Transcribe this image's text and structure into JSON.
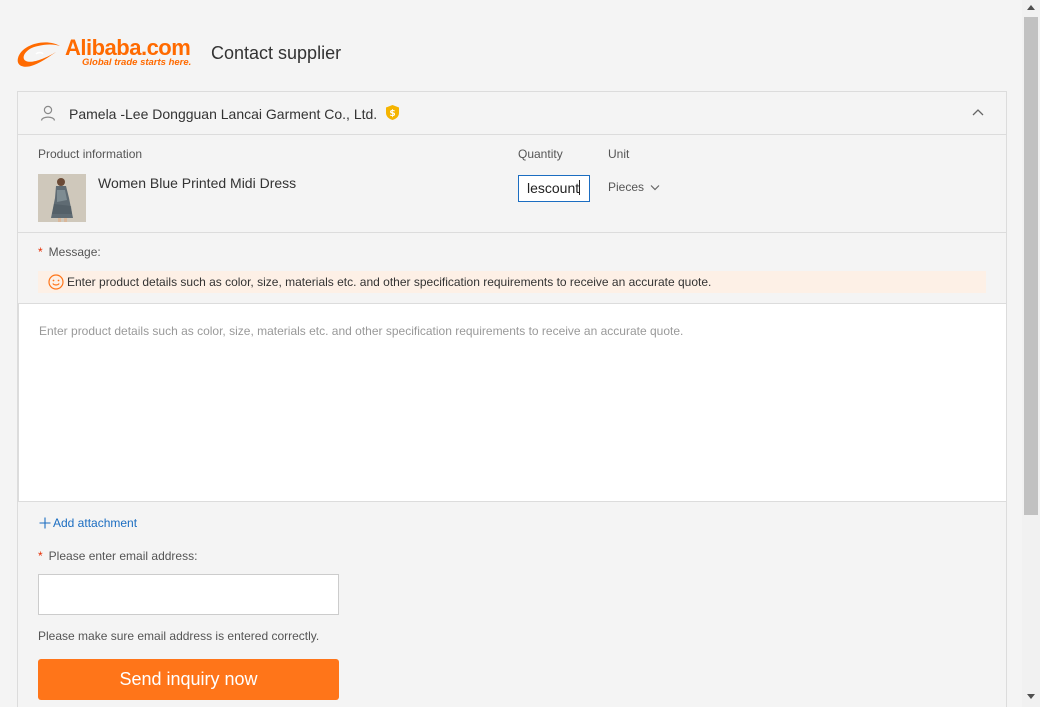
{
  "header": {
    "logo_text": "Alibaba.com",
    "logo_tagline": "Global trade starts here.",
    "title": "Contact supplier"
  },
  "supplier": {
    "name": "Pamela -Lee Dongguan Lancai Garment Co., Ltd.",
    "badge_icon": "gold-supplier-icon",
    "collapse_icon": "chevron-up-icon"
  },
  "product": {
    "info_label": "Product information",
    "quantity_label": "Quantity",
    "unit_label": "Unit",
    "name": "Women Blue Printed Midi Dress",
    "quantity_value": "lescount",
    "unit_value": "Pieces"
  },
  "message": {
    "required_mark": "*",
    "label": "Message:",
    "tip": "Enter product details such as color, size, materials etc. and other specification requirements to receive an accurate quote.",
    "placeholder": "Enter product details such as color, size, materials etc. and other specification requirements to receive an accurate quote."
  },
  "attachment": {
    "label": "Add attachment"
  },
  "email": {
    "required_mark": "*",
    "label": "Please enter email address:",
    "value": "",
    "hint": "Please make sure email address is entered correctly."
  },
  "actions": {
    "send_label": "Send inquiry now"
  },
  "colors": {
    "brand": "#ff6a00",
    "button": "#ff7519",
    "link": "#1b6dc1",
    "required": "#e62e04",
    "tip_bg": "#fdf0e6"
  }
}
